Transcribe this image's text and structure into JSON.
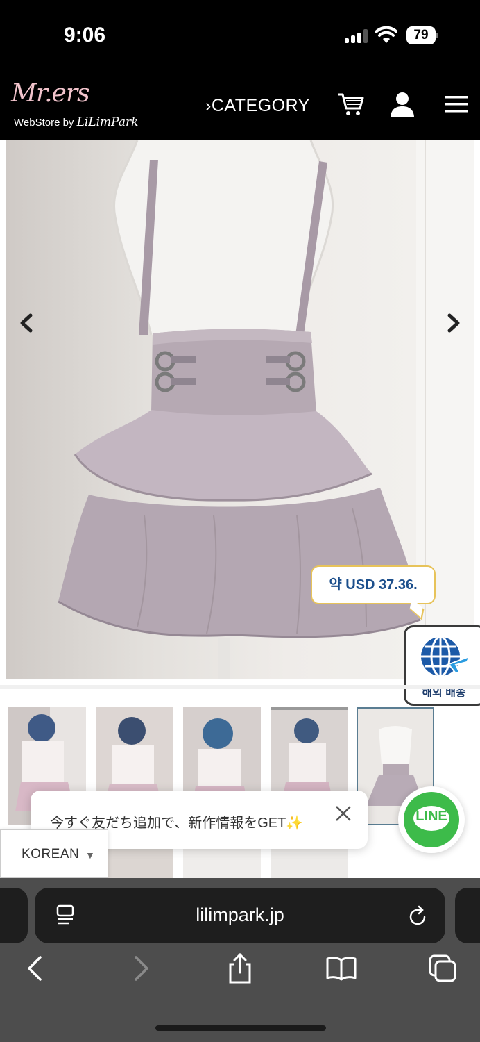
{
  "status_bar": {
    "time": "9:06",
    "battery": "79"
  },
  "header": {
    "logo_script": "Mr.ers",
    "logo_sub_prefix": "WebStore by",
    "logo_sub_brand": "LiLimPark",
    "category_label": "CATEGORY",
    "icons": [
      "cart-icon",
      "user-icon",
      "menu-icon"
    ]
  },
  "product": {
    "price_bubble": "약 USD 37.36.",
    "shipping_badge": "해외 배송",
    "thumbnails_selected_index": 4
  },
  "line_banner": {
    "text": "今すぐ友だち追加で、新作情報をGET✨",
    "button_label": "LINE"
  },
  "language": {
    "selected": "KOREAN"
  },
  "browser": {
    "url": "lilimpark.jp"
  },
  "colors": {
    "price_text": "#1c4f8c",
    "bubble_border": "#e7c35a",
    "line_green": "#3dbb4a"
  }
}
